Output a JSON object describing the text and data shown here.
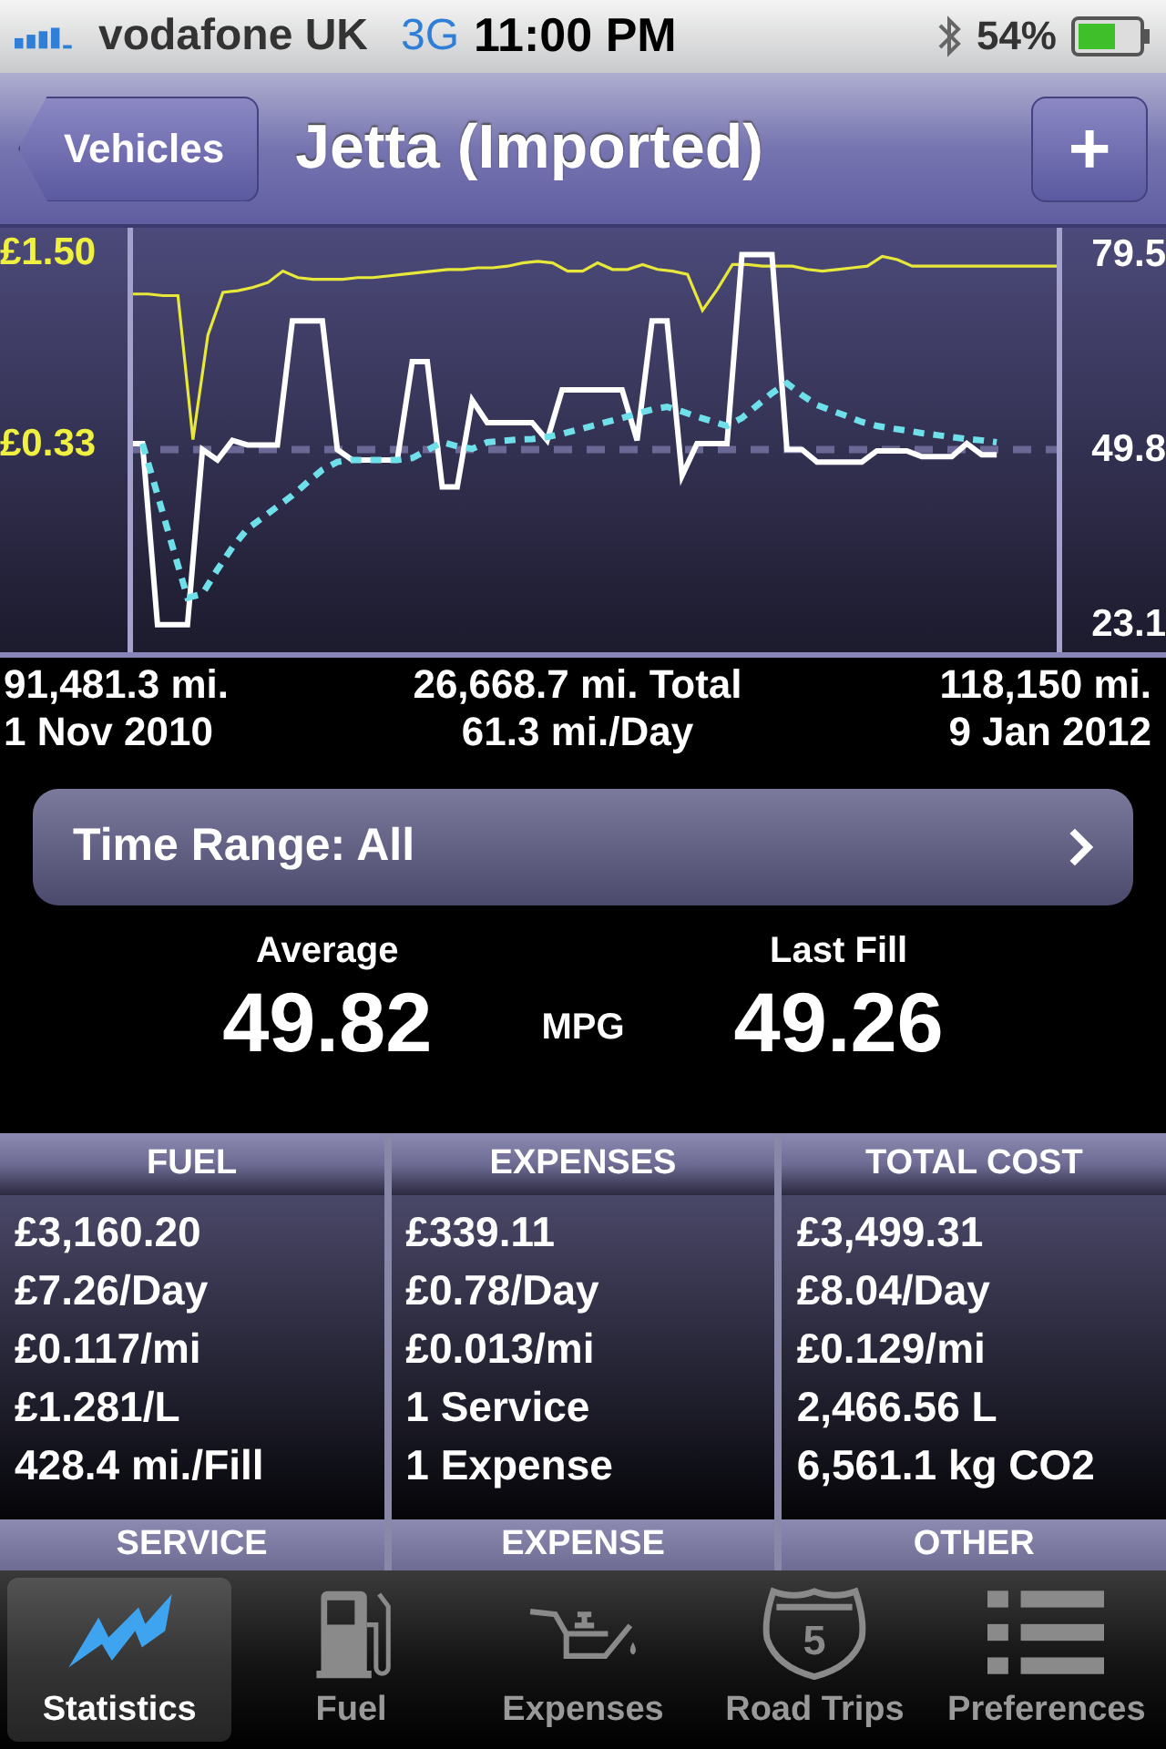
{
  "status_bar": {
    "carrier": "vodafone UK",
    "network": "3G",
    "time": "11:00 PM",
    "battery": "54%"
  },
  "nav": {
    "back": "Vehicles",
    "title": "Jetta (Imported)",
    "action": "+"
  },
  "chart": {
    "price": {
      "chart_data": {
        "type": "line",
        "categories": [
          null,
          null,
          null,
          null,
          null,
          null,
          null,
          null,
          null,
          null,
          null,
          null,
          null,
          null,
          null,
          null,
          null,
          null,
          null,
          null,
          null,
          null,
          null,
          null,
          null,
          null,
          null,
          null,
          null,
          null,
          null,
          null,
          null,
          null,
          null,
          null,
          null,
          null,
          null,
          null,
          null,
          null,
          null,
          null,
          null,
          null,
          null,
          null,
          null,
          null,
          null,
          null,
          null,
          null,
          null,
          null,
          null,
          null,
          null,
          null,
          null,
          null,
          null
        ],
        "ylim": [
          -0.94,
          1.655
        ],
        "yticks": [
          {
            "value": 1.5,
            "label": "£1.50"
          },
          {
            "value": 0.33,
            "label": "£0.33"
          }
        ],
        "series": [
          {
            "color": "#e8e83a",
            "values": [
              1.25,
              1.25,
              1.24,
              1.24,
              0.36,
              1.0,
              1.26,
              1.27,
              1.29,
              1.32,
              1.39,
              1.35,
              1.34,
              1.34,
              1.34,
              1.35,
              1.35,
              1.36,
              1.37,
              1.38,
              1.39,
              1.4,
              1.4,
              1.41,
              1.41,
              1.42,
              1.44,
              1.45,
              1.44,
              1.39,
              1.39,
              1.44,
              1.4,
              1.4,
              1.43,
              1.4,
              1.39,
              1.37,
              1.15,
              1.28,
              1.43,
              1.43,
              1.42,
              1.42,
              1.42,
              1.4,
              1.39,
              1.4,
              1.41,
              1.42,
              1.48,
              1.46,
              1.42,
              1.42,
              1.42,
              1.42,
              1.42,
              1.42,
              1.42,
              1.42,
              1.42,
              1.42,
              1.42
            ]
          }
        ]
      }
    },
    "mpg": {
      "chart_data": {
        "type": "line",
        "categories": [
          null,
          null,
          null,
          null,
          null,
          null,
          null,
          null,
          null,
          null,
          null,
          null,
          null,
          null,
          null,
          null,
          null,
          null,
          null,
          null,
          null,
          null,
          null,
          null,
          null,
          null,
          null,
          null,
          null,
          null,
          null,
          null,
          null,
          null,
          null,
          null,
          null,
          null,
          null,
          null,
          null,
          null,
          null,
          null,
          null,
          null,
          null,
          null,
          null,
          null,
          null,
          null,
          null,
          null,
          null,
          null,
          null,
          null,
          null,
          null,
          null,
          null,
          null
        ],
        "ylim": [
          18.9,
          83.6
        ],
        "yticks": [
          {
            "value": 79.5,
            "label": "79.5"
          },
          {
            "value": 49.8,
            "label": "49.8"
          },
          {
            "value": 23.1,
            "label": "23.1"
          }
        ],
        "series": [
          {
            "color": "#ffffff",
            "values": [
              50.7,
              50.7,
              23.1,
              23.1,
              23.1,
              49.8,
              48.2,
              51.2,
              50.5,
              50.5,
              50.5,
              69.4,
              69.4,
              69.4,
              49.8,
              48.2,
              48.2,
              48.2,
              48.2,
              63.2,
              63.2,
              44.1,
              44.1,
              57.3,
              53.9,
              53.9,
              53.9,
              53.9,
              51.2,
              58.9,
              58.9,
              58.9,
              58.9,
              58.9,
              51.2,
              69.4,
              69.4,
              45.8,
              50.7,
              50.7,
              50.7,
              79.5,
              79.5,
              79.5,
              49.8,
              49.8,
              47.9,
              47.9,
              47.9,
              47.9,
              49.6,
              49.6,
              49.6,
              48.7,
              48.7,
              48.7,
              50.7,
              49.0,
              49.0,
              null,
              null,
              null,
              null
            ]
          },
          {
            "color": "#6fe0ea",
            "line_style": "dashed",
            "values": [
              null,
              50.7,
              42.9,
              35.0,
              27.2,
              27.8,
              31.5,
              34.9,
              37.7,
              39.4,
              41.1,
              42.8,
              44.8,
              46.7,
              47.9,
              48.2,
              48.2,
              48.2,
              48.2,
              48.5,
              49.7,
              50.9,
              50.3,
              49.9,
              50.9,
              51.1,
              51.3,
              51.4,
              51.7,
              52.2,
              52.8,
              53.4,
              54.0,
              54.6,
              55.3,
              55.9,
              56.3,
              55.6,
              54.8,
              54.1,
              53.4,
              54.6,
              56.5,
              58.4,
              59.9,
              58.1,
              56.6,
              55.7,
              54.9,
              54.0,
              53.4,
              53.0,
              52.7,
              52.3,
              52.0,
              51.7,
              51.4,
              51.2,
              50.9,
              null,
              null,
              null,
              null
            ]
          },
          {
            "color": "#6c6896",
            "line_style": "dashed",
            "values": [
              49.8,
              49.8,
              49.8,
              49.8,
              49.8,
              49.8,
              49.8,
              49.8,
              49.8,
              49.8,
              49.8,
              49.8,
              49.8,
              49.8,
              49.8,
              49.8,
              49.8,
              49.8,
              49.8,
              49.8,
              49.8,
              49.8,
              49.8,
              49.8,
              49.8,
              49.8,
              49.8,
              49.8,
              49.8,
              49.8,
              49.8,
              49.8,
              49.8,
              49.8,
              49.8,
              49.8,
              49.8,
              49.8,
              49.8,
              49.8,
              49.8,
              49.8,
              49.8,
              49.8,
              49.8,
              49.8,
              49.8,
              49.8,
              49.8,
              49.8,
              49.8,
              49.8,
              49.8,
              49.8,
              49.8,
              49.8,
              49.8,
              49.8,
              49.8,
              49.8,
              49.8,
              49.8,
              49.8
            ]
          }
        ]
      }
    }
  },
  "summary": {
    "start_odometer": "91,481.3 mi.",
    "total": "26,668.7 mi. Total",
    "end_odometer": "118,150 mi.",
    "start_date": "1 Nov 2010",
    "per_day": "61.3 mi./Day",
    "end_date": "9 Jan 2012"
  },
  "time_range": "Time Range: All",
  "averages": {
    "average_label": "Average",
    "average_value": "49.82",
    "unit": "MPG",
    "last_label": "Last Fill",
    "last_value": "49.26"
  },
  "table": {
    "columns": [
      {
        "heading": "FUEL",
        "lines": [
          "£3,160.20",
          "£7.26/Day",
          "£0.117/mi",
          "£1.281/L",
          "428.4 mi./Fill"
        ]
      },
      {
        "heading": "EXPENSES",
        "lines": [
          "£339.11",
          "£0.78/Day",
          "£0.013/mi",
          "1 Service",
          "1 Expense"
        ]
      },
      {
        "heading": "TOTAL COST",
        "lines": [
          "£3,499.31",
          "£8.04/Day",
          "£0.129/mi",
          "2,466.56 L",
          "6,561.1 kg CO2"
        ]
      }
    ],
    "next_headings": [
      "SERVICE",
      "EXPENSE",
      "OTHER"
    ]
  },
  "tab_bar": [
    {
      "kind": "statistics",
      "label": "Statistics",
      "selected": true
    },
    {
      "kind": "fuel",
      "label": "Fuel",
      "selected": false
    },
    {
      "kind": "expenses",
      "label": "Expenses",
      "selected": false
    },
    {
      "kind": "road_trips",
      "label": "Road Trips",
      "selected": false,
      "sign": "5"
    },
    {
      "kind": "preferences",
      "label": "Preferences",
      "selected": false
    }
  ]
}
